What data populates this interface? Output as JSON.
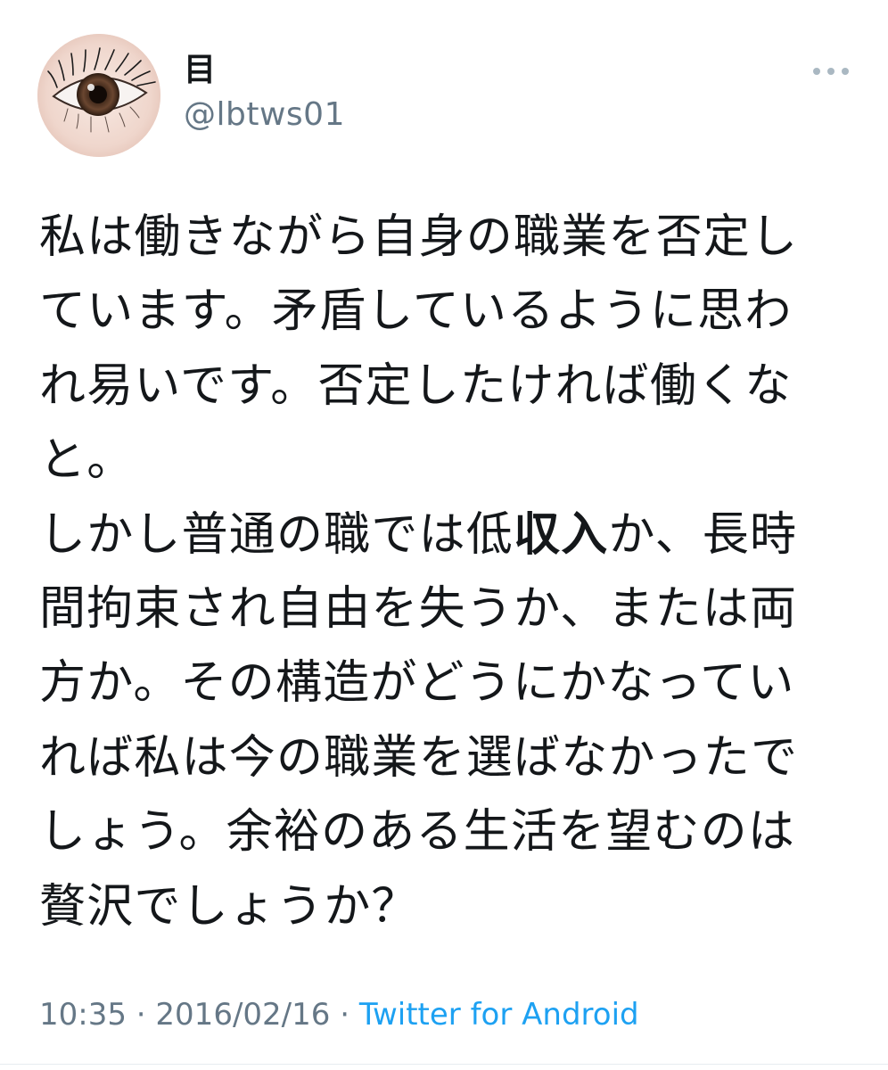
{
  "tweet": {
    "display_name": "目",
    "handle": "@lbtws01",
    "more_icon": "more-options-icon",
    "avatar_icon": "eye-avatar",
    "body_lines": [
      {
        "pre": "私は働きながら自身の職業を否定し",
        "bold": "",
        "post": ""
      },
      {
        "pre": "ています。矛盾しているように思わ",
        "bold": "",
        "post": ""
      },
      {
        "pre": "れ易いです。否定したければ働くな",
        "bold": "",
        "post": ""
      },
      {
        "pre": "と。",
        "bold": "",
        "post": ""
      },
      {
        "pre": "しかし普通の職では低",
        "bold": "収入",
        "post": "か、長時"
      },
      {
        "pre": "間拘束され自由を失うか、または両",
        "bold": "",
        "post": ""
      },
      {
        "pre": "方か。その構造がどうにかなってい",
        "bold": "",
        "post": ""
      },
      {
        "pre": "れば私は今の職業を選ばなかったで",
        "bold": "",
        "post": ""
      },
      {
        "pre": "しょう。余裕のある生活を望むのは",
        "bold": "",
        "post": ""
      },
      {
        "pre": "贅沢でしょうか？",
        "bold": "",
        "post": ""
      }
    ],
    "time": "10:35",
    "separator": " · ",
    "date": "2016/02/16",
    "source": "Twitter for Android",
    "colors": {
      "text": "#14171a",
      "secondary": "#657786",
      "link": "#1da1f2",
      "divider": "#e6ecf0"
    }
  }
}
